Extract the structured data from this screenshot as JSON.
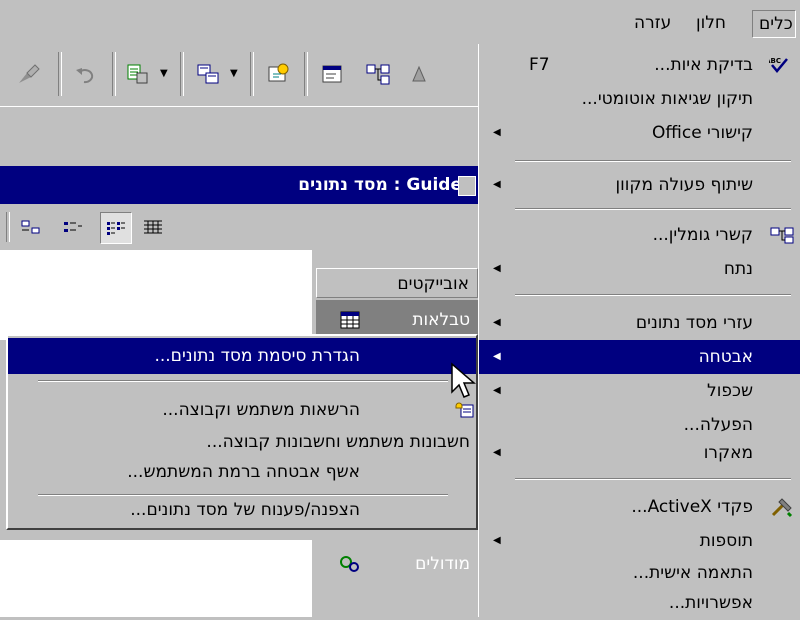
{
  "menubar": {
    "tools": "כלים",
    "window": "חלון",
    "help": "עזרה"
  },
  "db_window": {
    "title": "Guide : מסד נתונים",
    "objects_header": "אובייקטים",
    "objects": [
      {
        "label": "טבלאות",
        "icon": "table-icon"
      },
      {
        "label": "מודולים",
        "icon": "module-icon"
      }
    ]
  },
  "tools_menu": {
    "items": [
      {
        "label": "בדיקת איות...",
        "shortcut": "F7",
        "icon": "spellcheck-icon",
        "submenu": false
      },
      {
        "label": "תיקון שגיאות אוטומטי...",
        "submenu": false
      },
      {
        "label": "קישורי Office",
        "submenu": true
      },
      {
        "label": "שיתוף פעולה מקוון",
        "submenu": true
      },
      {
        "label": "קשרי גומלין...",
        "icon": "relationships-icon",
        "submenu": false
      },
      {
        "label": "נתח",
        "submenu": true
      },
      {
        "label": "עזרי מסד נתונים",
        "submenu": true
      },
      {
        "label": "אבטחה",
        "submenu": true
      },
      {
        "label": "שכפול",
        "submenu": true
      },
      {
        "label": "הפעלה...",
        "submenu": false
      },
      {
        "label": "מאקרו",
        "submenu": true
      },
      {
        "label": "פקדי ActiveX...",
        "icon": "activex-icon",
        "submenu": false
      },
      {
        "label": "תוספות",
        "submenu": true
      },
      {
        "label": "התאמה אישית...",
        "submenu": false
      },
      {
        "label": "אפשרויות...",
        "submenu": false
      }
    ]
  },
  "security_menu": {
    "items": [
      {
        "label": "הגדרת סיסמת מסד נתונים..."
      },
      {
        "label": "הרשאות משתמש וקבוצה...",
        "icon": "permissions-icon"
      },
      {
        "label": "חשבונות משתמש וחשבונות קבוצה..."
      },
      {
        "label": "אשף אבטחה ברמת המשתמש..."
      },
      {
        "label": "הצפנה/פענוח של מסד נתונים..."
      }
    ]
  },
  "colors": {
    "face": "#c0c0c0",
    "highlight": "#000080",
    "shadow": "#808080"
  }
}
